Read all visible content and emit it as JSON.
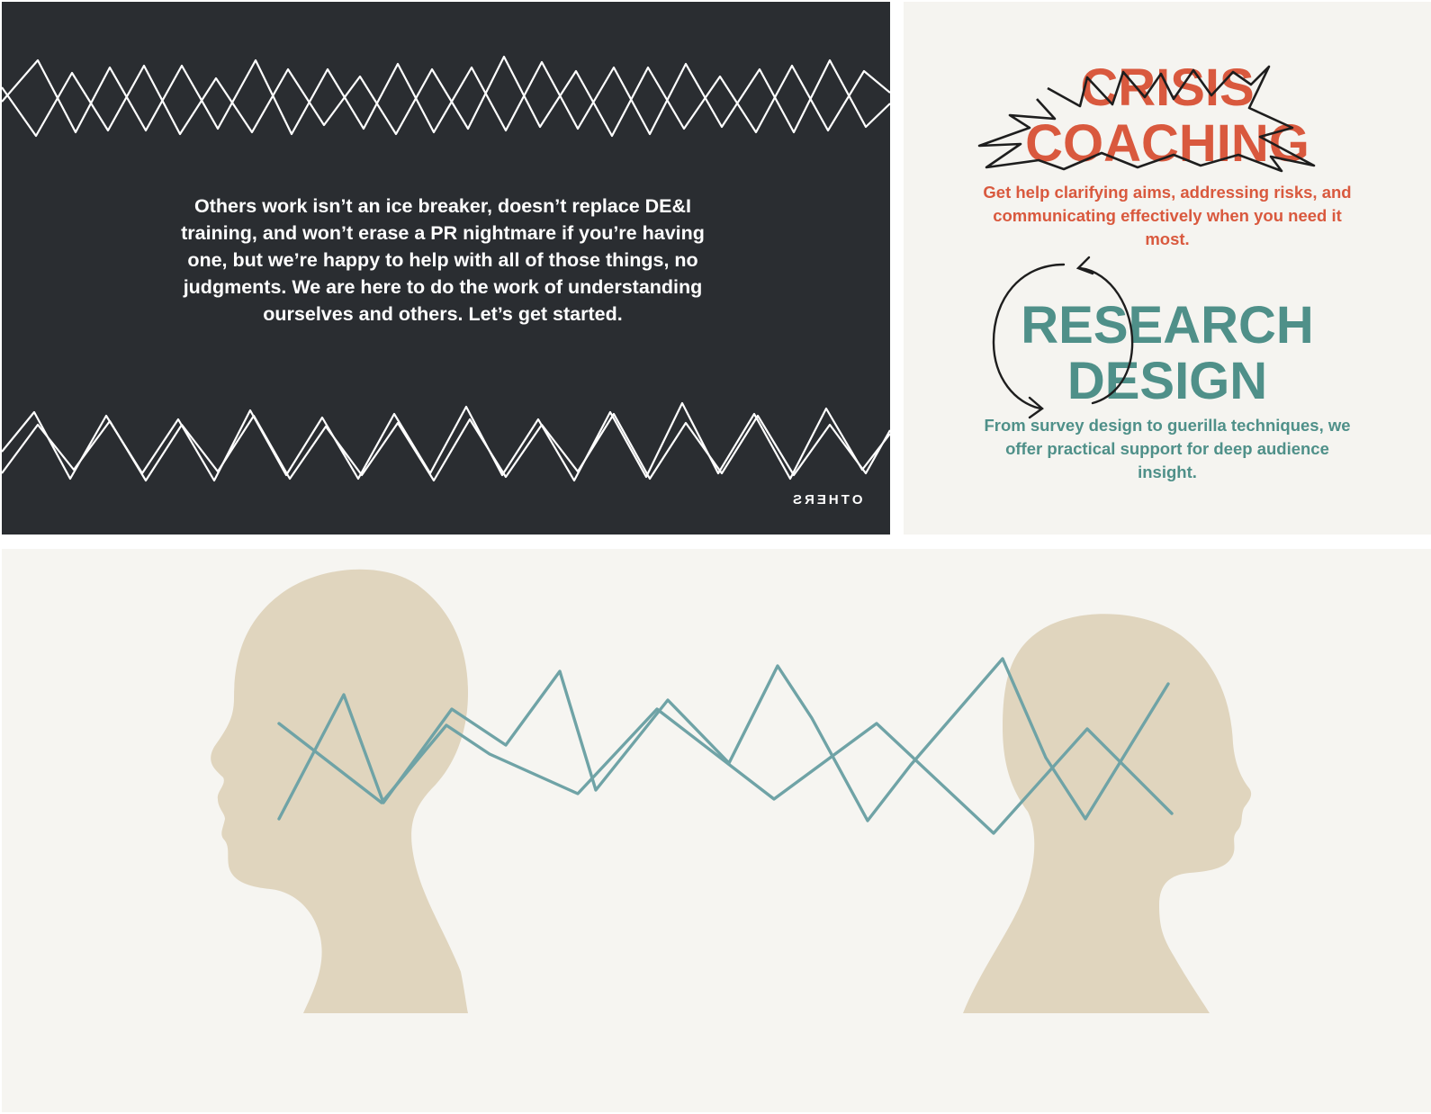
{
  "mission": {
    "text": "Others work isn’t an ice breaker, doesn’t replace DE&I training, and won’t erase a PR nightmare if you’re having one, but we’re happy to help with all of those things, no judgments. We are here to do the work of understanding ourselves and others. Let’s get started."
  },
  "brand": {
    "mark": "OTHERS"
  },
  "services": {
    "crisis": {
      "title_line1": "CRISIS",
      "title_line2": "COACHING",
      "description": "Get help clarifying aims, addressing risks, and communicating effectively when you need it most.",
      "color": "#d9593e"
    },
    "research": {
      "title_line1": "RESEARCH",
      "title_line2": "DESIGN",
      "description": "From survey design to guerilla techniques, we offer practical support for deep audience insight.",
      "color": "#4f9089"
    }
  },
  "colors": {
    "dark_bg": "#2a2d31",
    "cream_bg": "#f5f4f0",
    "head_fill": "#e0d5be",
    "connector": "#6fa3a6",
    "scribble": "#1e1e1e"
  },
  "icons": [
    "scribble-burst-icon",
    "cycle-arrows-icon",
    "zigzag-pattern",
    "head-silhouette"
  ]
}
